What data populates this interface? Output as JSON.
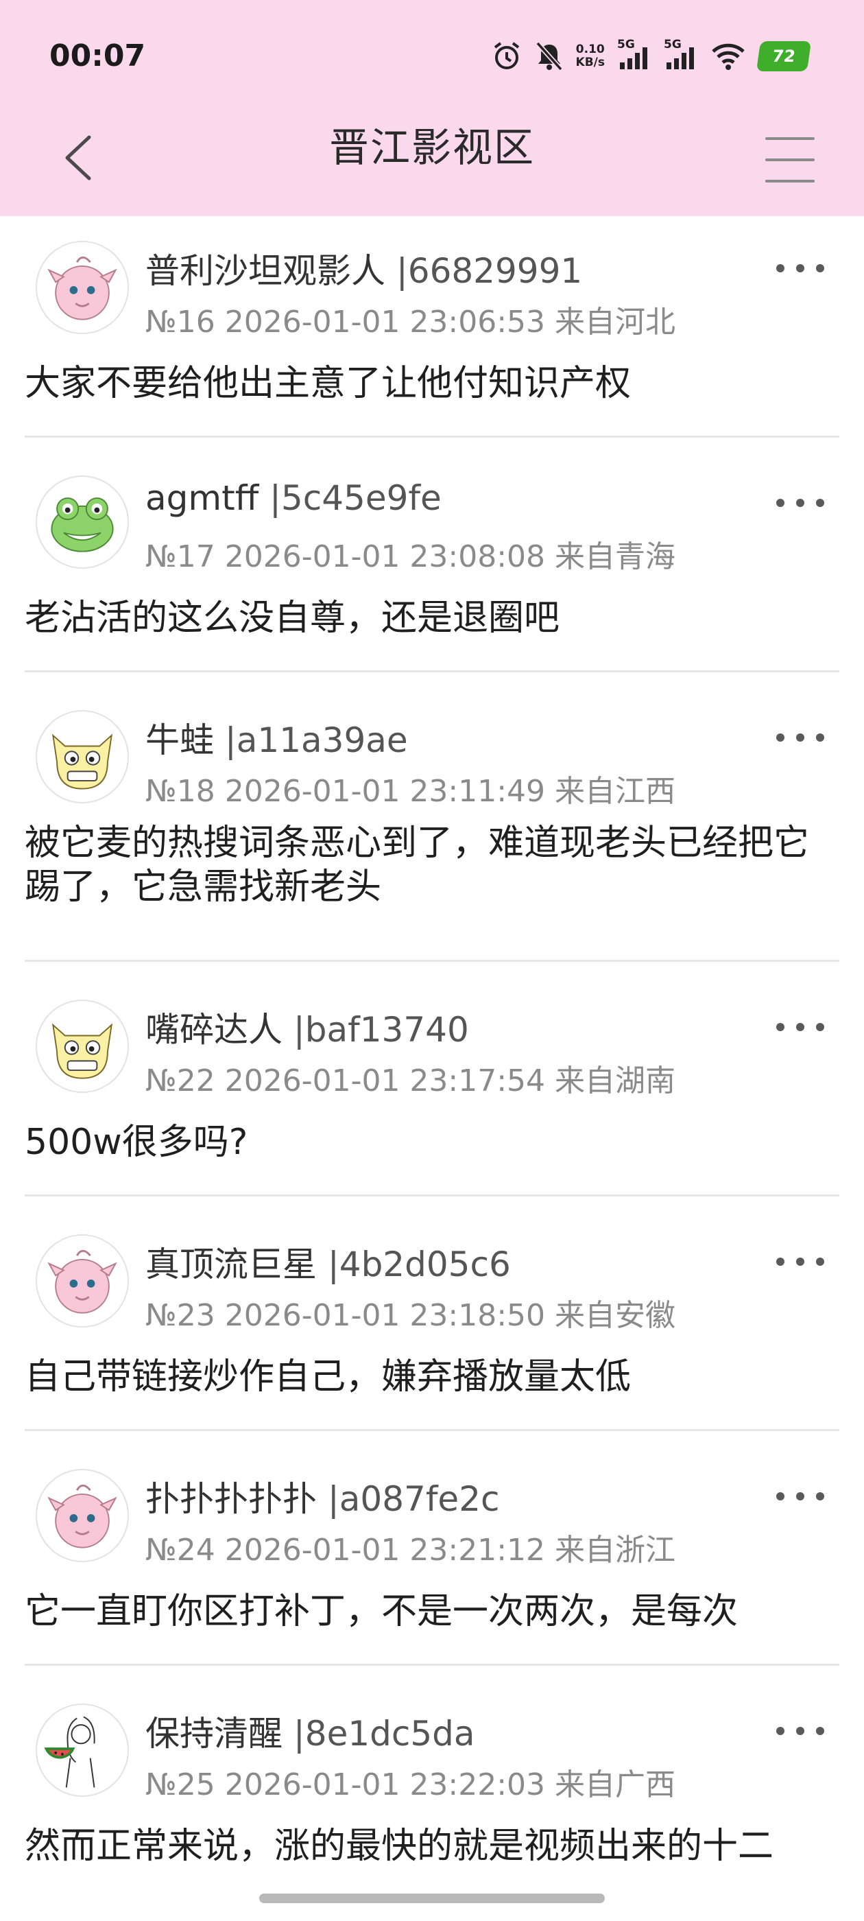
{
  "status_bar": {
    "time": "00:07",
    "net_speed_value": "0.10",
    "net_speed_unit": "KB/s",
    "sim1_label": "5G",
    "sim2_label": "5G",
    "battery_level": "72",
    "icons": [
      "alarm-icon",
      "mute-icon",
      "signal-icon",
      "signal-icon",
      "wifi-icon",
      "battery-icon"
    ]
  },
  "nav": {
    "title": "晋江影视区",
    "back_icon": "chevron-left-icon",
    "menu_icon": "hamburger-menu-icon"
  },
  "posts": [
    {
      "name": "普利沙坦观影人",
      "uid": "|66829991",
      "meta": "№16 2026-01-01 23:06:53 来自河北",
      "body": "大家不要给他出主意了让他付知识产权",
      "avatar": "pink-puff-avatar"
    },
    {
      "name": "agmtff",
      "uid": "|5c45e9fe",
      "meta": "№17 2026-01-01 23:08:08 来自青海",
      "body": "老沾活的这么没自尊，还是退圈吧",
      "avatar": "green-frog-avatar"
    },
    {
      "name": "牛蛙",
      "uid": "|a11a39ae",
      "meta": "№18 2026-01-01 23:11:49 来自江西",
      "body": "被它麦的热搜词条恶心到了，难道现老头已经把它踢了，它急需找新老头",
      "avatar": "yellow-cat-avatar"
    },
    {
      "name": "嘴碎达人",
      "uid": "|baf13740",
      "meta": "№22 2026-01-01 23:17:54 来自湖南",
      "body": "500w很多吗?",
      "avatar": "yellow-cat-avatar"
    },
    {
      "name": "真顶流巨星",
      "uid": "|4b2d05c6",
      "meta": "№23 2026-01-01 23:18:50 来自安徽",
      "body": "自己带链接炒作自己，嫌弃播放量太低",
      "avatar": "pink-puff-avatar"
    },
    {
      "name": "扑扑扑扑扑",
      "uid": "|a087fe2c",
      "meta": "№24 2026-01-01 23:21:12 来自浙江",
      "body": "它一直盯你区打补丁，不是一次两次，是每次",
      "avatar": "pink-puff-avatar"
    },
    {
      "name": "保持清醒",
      "uid": "|8e1dc5da",
      "meta": "№25 2026-01-01 23:22:03 来自广西",
      "body": "然而正常来说，涨的最快的就是视频出来的十二",
      "avatar": "sketch-girl-watermelon-avatar"
    }
  ]
}
